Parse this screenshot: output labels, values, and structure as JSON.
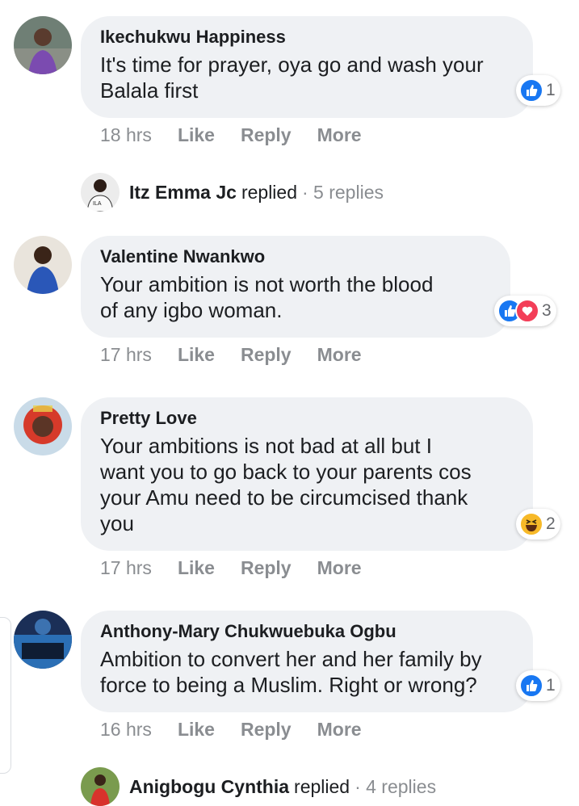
{
  "comments": [
    {
      "author": "Ikechukwu Happiness",
      "text_lines": [
        "It's time for prayer, oya go and wash your",
        "Balala first"
      ],
      "reaction_count": "1",
      "reactions": [
        "like-icon"
      ],
      "time": "18 hrs",
      "like_label": "Like",
      "reply_label": "Reply",
      "more_label": "More",
      "replied": {
        "name": "Itz Emma Jc",
        "word": "replied",
        "count": "· 5 replies"
      }
    },
    {
      "author": "Valentine Nwankwo",
      "text_lines": [
        "Your ambition is not worth the blood",
        "of any igbo woman."
      ],
      "reaction_count": "3",
      "reactions": [
        "like-icon",
        "love-icon"
      ],
      "time": "17 hrs",
      "like_label": "Like",
      "reply_label": "Reply",
      "more_label": "More"
    },
    {
      "author": "Pretty Love",
      "text_lines": [
        "Your ambitions is not bad at all but I",
        "want you to go back to your parents cos",
        "your Amu need to be circumcised thank",
        "you"
      ],
      "reaction_count": "2",
      "reactions": [
        "haha-icon"
      ],
      "time": "17 hrs",
      "like_label": "Like",
      "reply_label": "Reply",
      "more_label": "More"
    },
    {
      "author": "Anthony-Mary Chukwuebuka Ogbu",
      "text_lines": [
        "Ambition to convert her and her family by",
        "force to being a Muslim. Right or wrong?"
      ],
      "reaction_count": "1",
      "reactions": [
        "like-icon"
      ],
      "time": "16 hrs",
      "like_label": "Like",
      "reply_label": "Reply",
      "more_label": "More",
      "replied": {
        "name": "Anigbogu Cynthia",
        "word": "replied",
        "count": "· 4 replies"
      }
    }
  ],
  "colors": {
    "bubble": "#eff1f4",
    "like_blue": "#1877f2",
    "love_red": "#f33e58",
    "haha_yellow": "#f7b928",
    "meta_gray": "#8a8d91"
  }
}
